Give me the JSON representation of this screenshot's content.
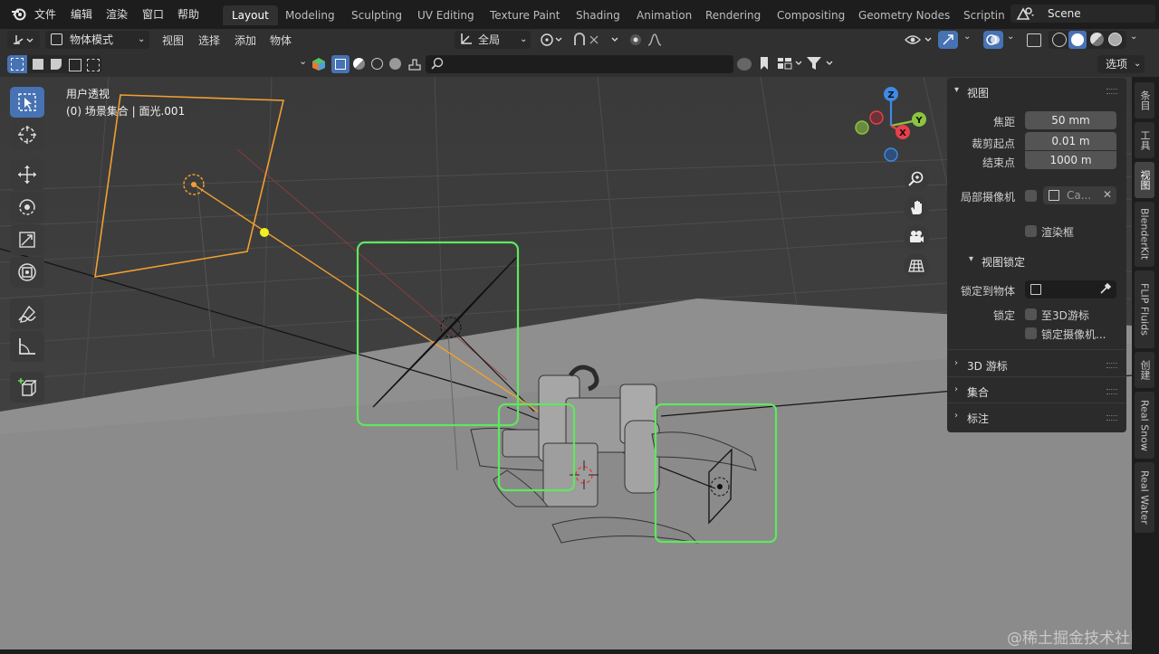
{
  "topbar": {
    "menus": [
      "文件",
      "编辑",
      "渲染",
      "窗口",
      "帮助"
    ],
    "workspaces": [
      "Layout",
      "Modeling",
      "Sculpting",
      "UV Editing",
      "Texture Paint",
      "Shading",
      "Animation",
      "Rendering",
      "Compositing",
      "Geometry Nodes",
      "Scriptin"
    ],
    "scene_name": "Scene"
  },
  "header": {
    "mode": "物体模式",
    "menus": [
      "视图",
      "选择",
      "添加",
      "物体"
    ],
    "transform_orientation": "全局",
    "options_label": "选项"
  },
  "viewport": {
    "view_name": "用户透视",
    "collection_info": "(0) 场景集合 | 面光.001",
    "watermark": "@稀土掘金技术社区",
    "colors": {
      "selection": "#5ee85e",
      "light": "#f0a030",
      "axis_x": "#e8404a",
      "axis_y": "#8cc63f",
      "axis_z": "#3f8ae8"
    },
    "gizmo": {
      "x": "X",
      "y": "Y",
      "z": "Z"
    }
  },
  "npanel": {
    "view_section": "视图",
    "focal_label": "焦距",
    "focal_value": "50 mm",
    "clip_start_label": "裁剪起点",
    "clip_start_value": "0.01 m",
    "clip_end_label": "结束点",
    "clip_end_value": "1000 m",
    "local_camera_label": "局部摄像机",
    "local_camera_value": "Ca...",
    "render_region_label": "渲染框",
    "view_lock_section": "视图锁定",
    "lock_object_label": "锁定到物体",
    "lock_label": "锁定",
    "lock_cursor_label": "至3D游标",
    "lock_camera_label": "锁定摄像机...",
    "cursor_section": "3D 游标",
    "collection_section": "集合",
    "annotation_section": "标注"
  },
  "side_tabs": [
    "条目",
    "工具",
    "视图",
    "BlenderKit",
    "FLIP Fluids",
    "创建",
    "Real Snow",
    "Real Water"
  ]
}
